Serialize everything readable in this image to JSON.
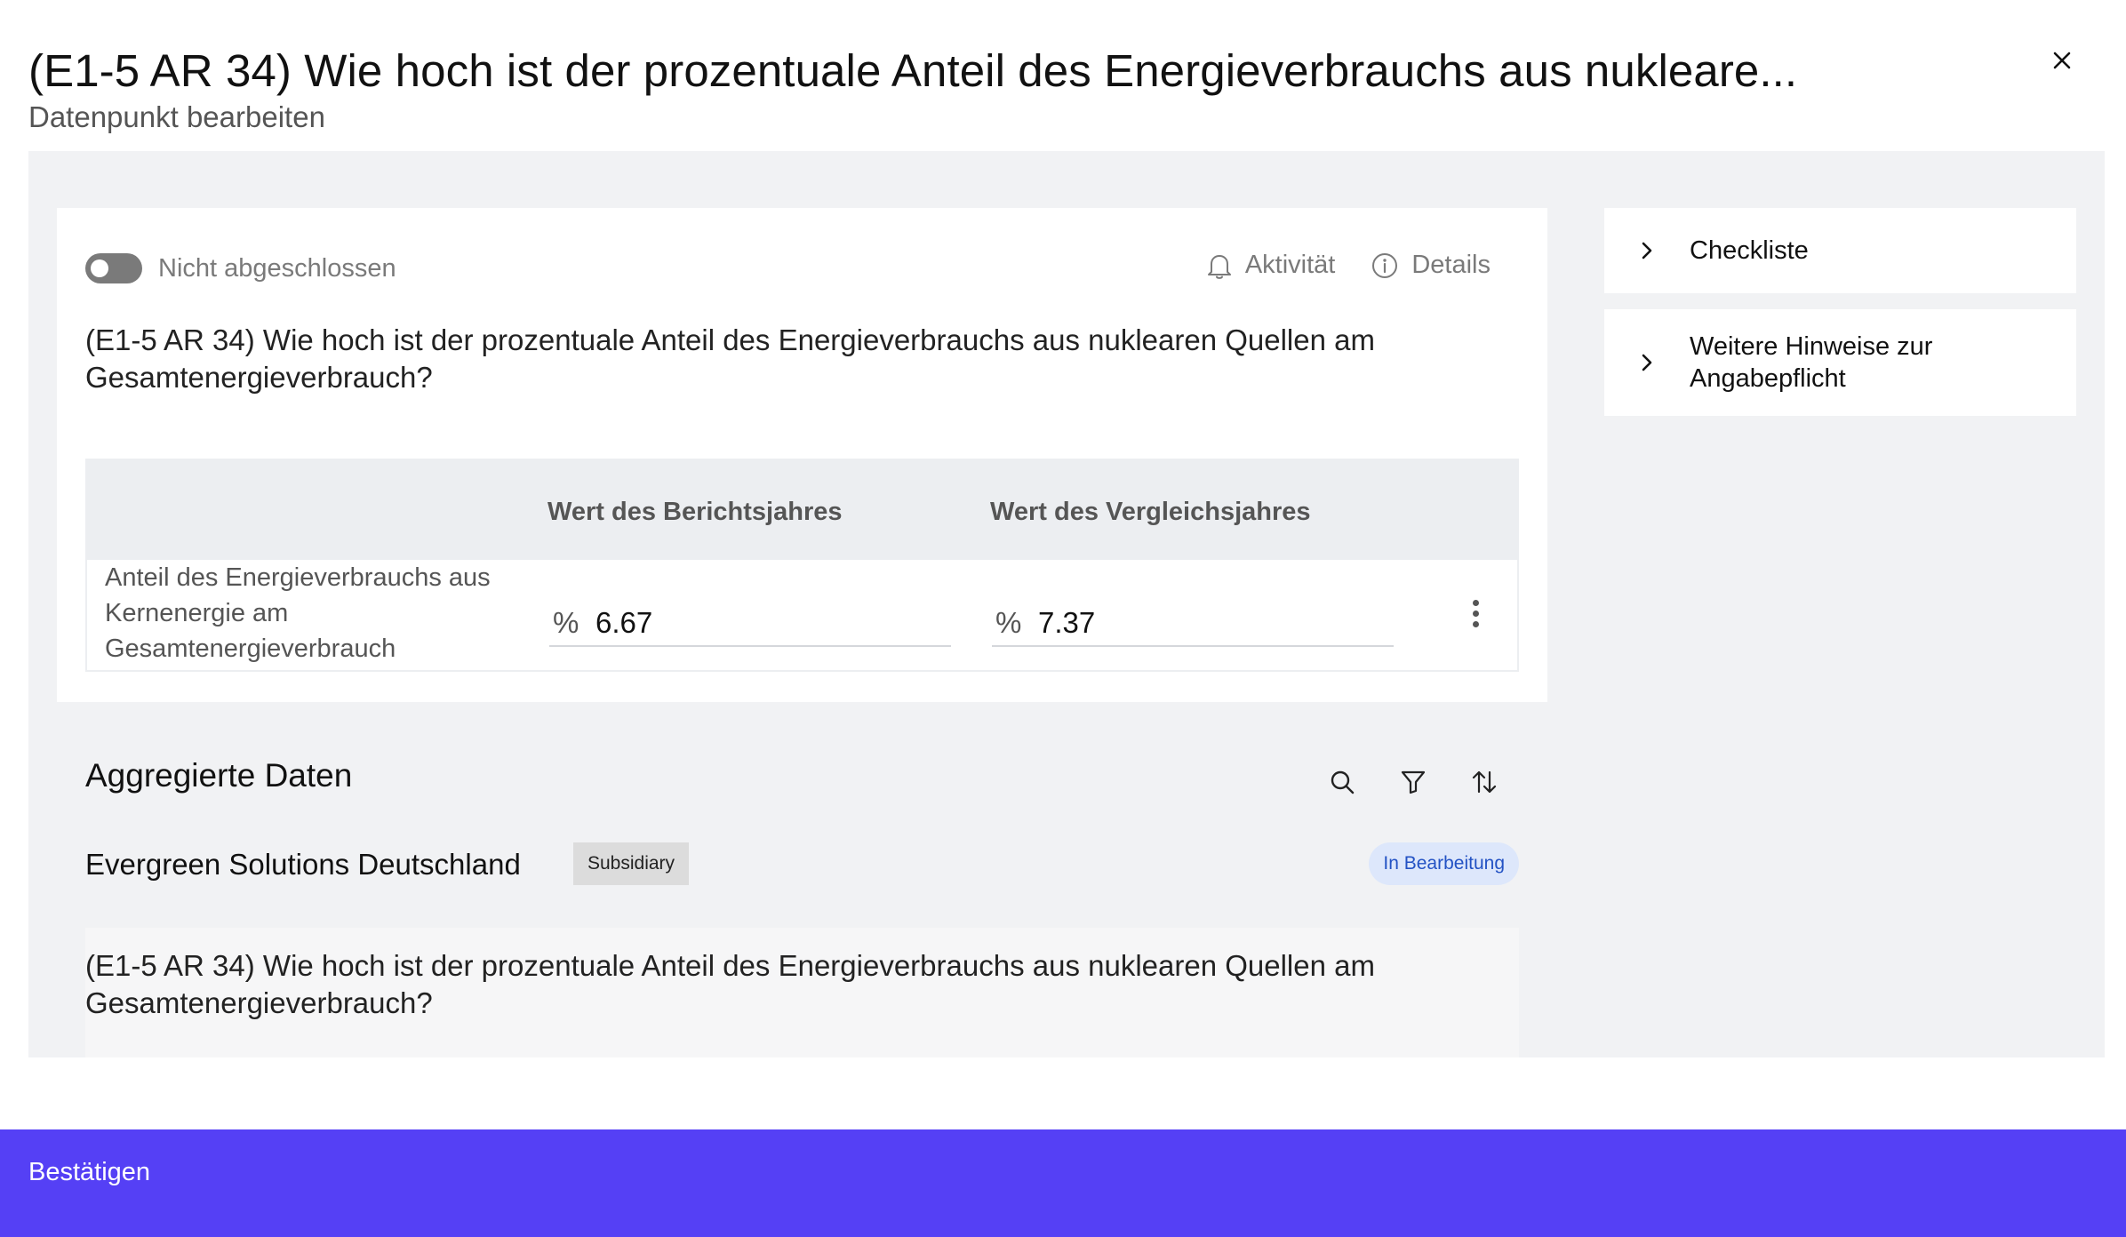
{
  "dialog": {
    "title": "(E1-5 AR 34) Wie hoch ist der prozentuale Anteil des Energieverbrauchs aus nukleare...",
    "subtitle": "Datenpunkt bearbeiten",
    "close_icon": "close-icon"
  },
  "main_card": {
    "status_label": "Nicht abgeschlossen",
    "toggle_on": false,
    "actions": {
      "activity": "Aktivität",
      "details": "Details"
    },
    "question": "(E1-5 AR 34) Wie hoch ist der prozentuale Anteil des Energieverbrauchs aus nuklearen Quellen am Gesamtenergieverbrauch?",
    "table": {
      "columns": [
        "",
        "Wert des Berichtsjahres",
        "Wert des Vergleichsjahres"
      ],
      "rows": [
        {
          "label": "Anteil des Energieverbrauchs aus Kernenergie am Gesamtenergieverbrauch",
          "reporting_unit": "%",
          "reporting_value": "6.67",
          "comparison_unit": "%",
          "comparison_value": "7.37"
        }
      ]
    }
  },
  "aggregated": {
    "title": "Aggregierte Daten",
    "tools": [
      "search-icon",
      "filter-icon",
      "sort-icon"
    ],
    "entity": {
      "name": "Evergreen Solutions Deutschland",
      "tag": "Subsidiary",
      "status": "In Bearbeitung"
    },
    "question": "(E1-5 AR 34) Wie hoch ist der prozentuale Anteil des Energieverbrauchs aus nuklearen Quellen am Gesamtenergieverbrauch?"
  },
  "side_panel": {
    "items": [
      {
        "label": "Checkliste"
      },
      {
        "label": "Weitere Hinweise zur Angabepflicht"
      }
    ]
  },
  "footer": {
    "confirm_label": "Bestätigen"
  },
  "colors": {
    "accent": "#5540f5",
    "status_bg": "#dde7fb",
    "status_text": "#2352c4",
    "panel_bg": "#f1f2f4"
  }
}
